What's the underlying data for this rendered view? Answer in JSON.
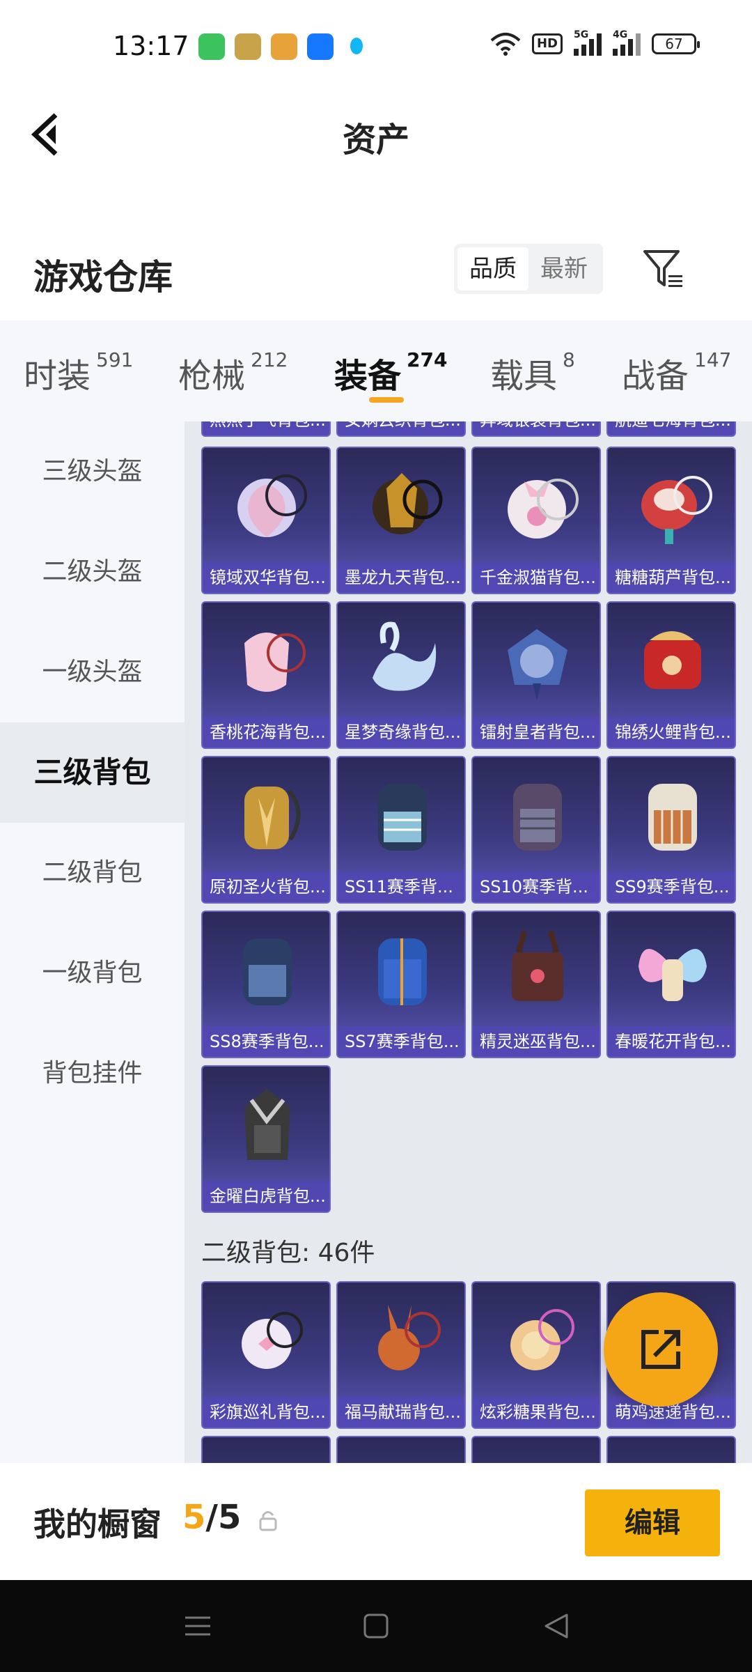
{
  "status_bar": {
    "time": "13:17",
    "battery": "67",
    "hd": "HD",
    "net1": "5G",
    "net2": "4G"
  },
  "header": {
    "title": "资产"
  },
  "section": {
    "title": "游戏仓库",
    "sort_options": [
      "品质",
      "最新"
    ],
    "active_sort": "品质"
  },
  "tabs": [
    {
      "label": "时装",
      "count": "591"
    },
    {
      "label": "枪械",
      "count": "212"
    },
    {
      "label": "装备",
      "count": "274"
    },
    {
      "label": "载具",
      "count": "8"
    },
    {
      "label": "战备",
      "count": "147"
    }
  ],
  "active_tab": "装备",
  "sidebar": {
    "items": [
      "三级头盔",
      "二级头盔",
      "一级头盔",
      "三级背包",
      "二级背包",
      "一级背包",
      "背包挂件"
    ],
    "active": "三级背包"
  },
  "partial_top_row": [
    "燕燕于飞背包...",
    "女娲云织背包...",
    "异域银装背包...",
    "航遥七海背包..."
  ],
  "level3_items": [
    "镜域双华背包...",
    "墨龙九天背包...",
    "千金淑猫背包...",
    "糖糖葫芦背包...",
    "香桃花海背包...",
    "星梦奇缘背包...",
    "镭射皇者背包...",
    "锦绣火鲤背包...",
    "原初圣火背包...",
    "SS11赛季背...",
    "SS10赛季背...",
    "SS9赛季背包...",
    "SS8赛季背包...",
    "SS7赛季背包...",
    "精灵迷巫背包...",
    "春暖花开背包...",
    "金曜白虎背包..."
  ],
  "level2_group": {
    "title": "二级背包: 46件"
  },
  "level2_items": [
    "彩旗巡礼背包...",
    "福马献瑞背包...",
    "炫彩糖果背包...",
    "萌鸡速递背包..."
  ],
  "bottom": {
    "showcase_label": "我的橱窗",
    "used": "5",
    "sep": "/",
    "total": "5",
    "edit_label": "编辑"
  },
  "colors": {
    "accent": "#f5a617",
    "card": "#3c3a80"
  }
}
